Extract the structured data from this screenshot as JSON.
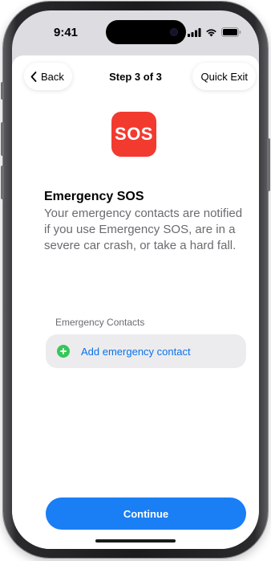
{
  "status_bar": {
    "time": "9:41",
    "icons": [
      "signal-icon",
      "wifi-icon",
      "battery-icon"
    ]
  },
  "nav": {
    "back_label": "Back",
    "title": "Step 3 of 3",
    "quick_exit_label": "Quick Exit"
  },
  "app_icon": {
    "text": "SOS",
    "color": "#f33a2f"
  },
  "content": {
    "heading": "Emergency SOS",
    "description": "Your emergency contacts are notified if you use Emergency SOS, are in a severe car crash, or take a hard fall."
  },
  "contacts_section": {
    "header": "Emergency Contacts",
    "add_label": "Add emergency contact",
    "add_icon_color": "#34c759"
  },
  "footer": {
    "continue_label": "Continue",
    "accent_color": "#1a7ef5"
  }
}
